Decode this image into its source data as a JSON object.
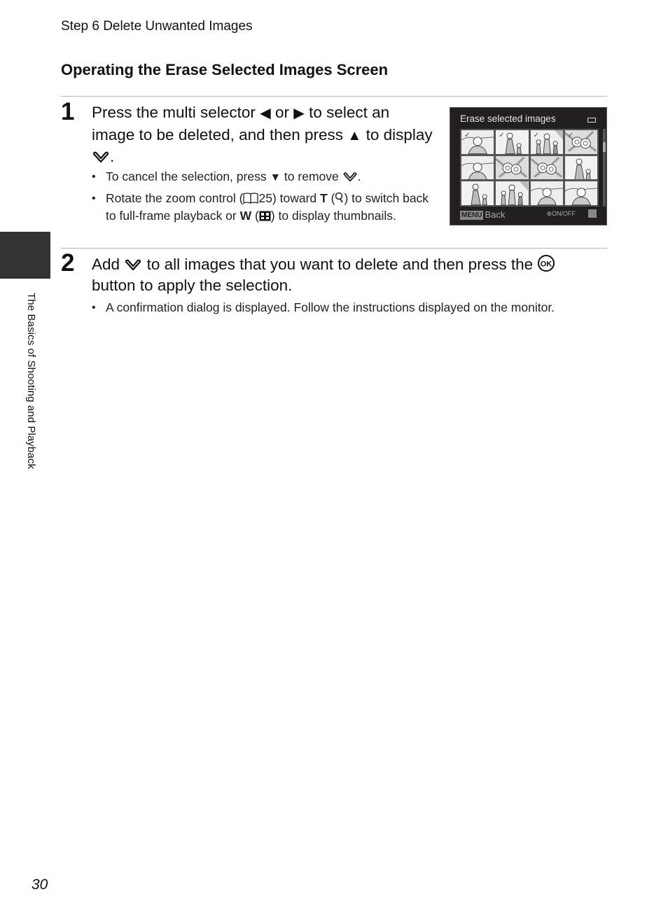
{
  "header": {
    "running_head": "Step 6 Delete Unwanted Images",
    "section_title": "Operating the Erase Selected Images Screen"
  },
  "side_tab": {
    "label": "The Basics of Shooting and Playback"
  },
  "steps": [
    {
      "number": "1",
      "heading": {
        "part1": "Press the multi selector",
        "left_arrow": "◀",
        "or": "or",
        "right_arrow": "▶",
        "part2": "to select an image to be deleted, and then press",
        "up_arrow": "▲",
        "part3": "to display",
        "end": "."
      },
      "bullets": [
        {
          "text1": "To cancel the selection, press",
          "down_arrow": "▼",
          "text2": "to remove",
          "end": "."
        },
        {
          "text1": "Rotate the zoom control (",
          "page_ref": "25",
          "text2": ") toward",
          "t_letter": "T",
          "text3": "(",
          "text4": ") to switch back to full-frame playback or",
          "w_letter": "W",
          "text5": "(",
          "text6": ") to display thumbnails."
        }
      ]
    },
    {
      "number": "2",
      "heading": {
        "part1": "Add",
        "part2": "to all images that you want to delete and then press the",
        "part3": "button to apply the selection."
      },
      "bullets": [
        {
          "text": "A confirmation dialog is displayed. Follow the instructions displayed on the monitor."
        }
      ]
    }
  ],
  "camera_screen": {
    "title": "Erase selected images",
    "thumbnails": [
      {
        "subject": "woman-portrait",
        "selected": true
      },
      {
        "subject": "woman-child",
        "selected": true
      },
      {
        "subject": "family-walk",
        "selected": true
      },
      {
        "subject": "flowers",
        "selected": true
      },
      {
        "subject": "woman-portrait",
        "selected": false
      },
      {
        "subject": "flowers",
        "selected": false
      },
      {
        "subject": "flowers",
        "selected": false
      },
      {
        "subject": "woman-child",
        "selected": false
      },
      {
        "subject": "woman-child",
        "selected": false
      },
      {
        "subject": "family-walk",
        "selected": false
      },
      {
        "subject": "woman-portrait",
        "selected": false
      },
      {
        "subject": "woman-portrait",
        "selected": false
      }
    ],
    "check_mark": "✓",
    "menu_badge": "MENU",
    "back_label": "Back",
    "onoff_label": "ON/OFF",
    "scroll_position": 0.2
  },
  "footer": {
    "page_number": "30"
  }
}
